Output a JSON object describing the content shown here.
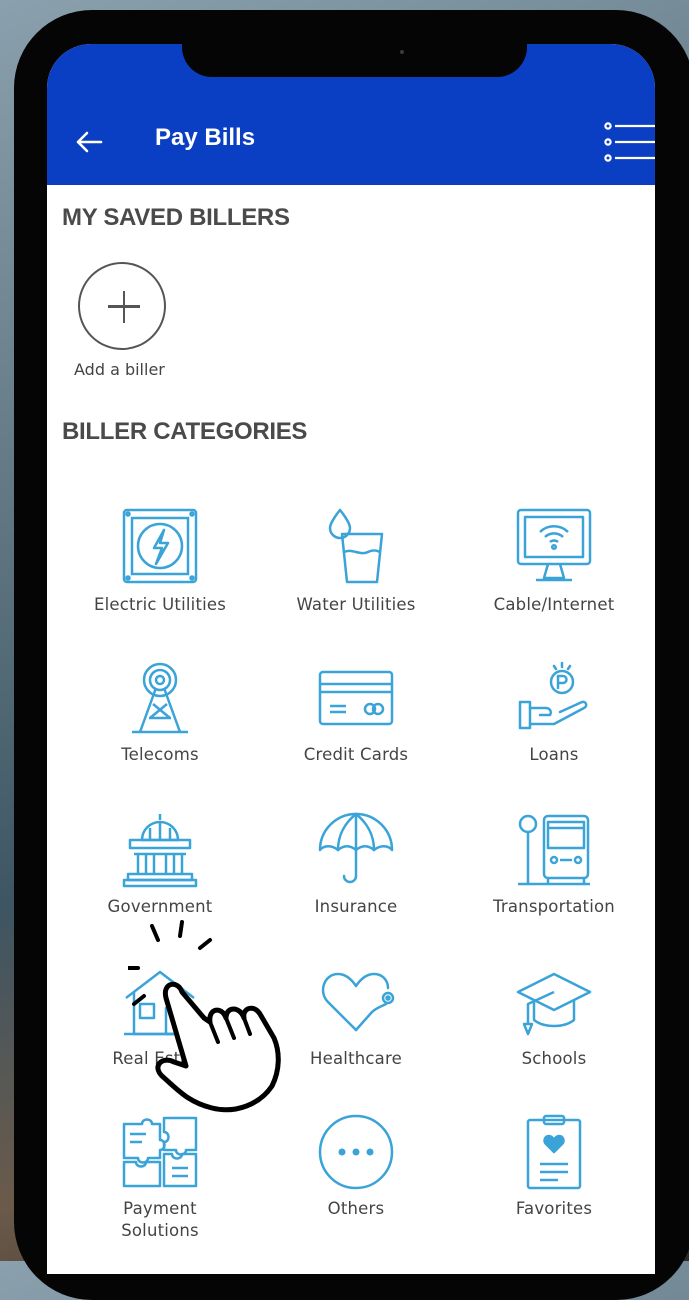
{
  "header": {
    "title": "Pay Bills",
    "back_icon": "arrow-left-icon",
    "menu_icon": "list-menu-icon",
    "color": "#0a3fc3"
  },
  "saved_billers": {
    "heading": "MY SAVED BILLERS",
    "add_label": "Add a biller"
  },
  "categories_section": {
    "heading": "BILLER CATEGORIES",
    "icon_color": "#3aa3d8",
    "items": [
      {
        "label": "Electric Utilities",
        "icon": "electric-icon"
      },
      {
        "label": "Water Utilities",
        "icon": "water-glass-icon"
      },
      {
        "label": "Cable/Internet",
        "icon": "monitor-wifi-icon"
      },
      {
        "label": "Telecoms",
        "icon": "radio-tower-icon"
      },
      {
        "label": "Credit Cards",
        "icon": "credit-card-icon"
      },
      {
        "label": "Loans",
        "icon": "hand-coin-icon"
      },
      {
        "label": "Government",
        "icon": "government-building-icon"
      },
      {
        "label": "Insurance",
        "icon": "umbrella-icon"
      },
      {
        "label": "Transportation",
        "icon": "bus-stop-icon"
      },
      {
        "label": "Real Estate",
        "icon": "house-icon"
      },
      {
        "label": "Healthcare",
        "icon": "heart-stethoscope-icon"
      },
      {
        "label": "Schools",
        "icon": "graduation-cap-icon"
      },
      {
        "label": "Payment\nSolutions",
        "icon": "puzzle-icon"
      },
      {
        "label": "Others",
        "icon": "ellipsis-icon"
      },
      {
        "label": "Favorites",
        "icon": "clipboard-heart-icon"
      }
    ]
  },
  "overlay": {
    "tap_hand_icon": "tap-hand-icon"
  }
}
